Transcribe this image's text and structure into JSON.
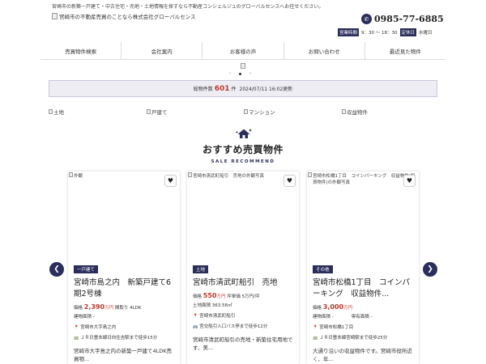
{
  "header": {
    "tagline": "宮崎市の新築一戸建て・中古住宅・売地・土地情報を探すなら不動産コンシェルジュのグローバルセンスへお任せください。",
    "logo_alt": "宮崎市の不動産売買のことなら株式会社グローバルセンス",
    "phone": "0985-77-6885",
    "hours_label": "営業時間",
    "hours_value": "9：30 ～ 18：30",
    "holiday_label": "定休日",
    "holiday_value": "水曜日"
  },
  "nav": [
    {
      "label": "売買物件検索"
    },
    {
      "label": "会社案内"
    },
    {
      "label": "お客様の声"
    },
    {
      "label": "お問い合わせ"
    },
    {
      "label": "最近見た物件"
    }
  ],
  "slider": {
    "prev": "‹",
    "next": "›"
  },
  "counter": {
    "label": "総物件数",
    "count": "601",
    "unit": "件",
    "updated": "2024/07/11 16:02更新"
  },
  "categories": [
    {
      "label": "土地"
    },
    {
      "label": "戸建て"
    },
    {
      "label": "マンション"
    },
    {
      "label": "収益物件"
    }
  ],
  "section": {
    "title": "おすすめ売買物件",
    "subtitle": "SALE RECOMMEND"
  },
  "cards": [
    {
      "img_alt": "外観",
      "badge": "一戸建て",
      "title": "宮崎市島之内　新築戸建て6期2号棟",
      "price_label": "価格",
      "price_value": "2,390",
      "price_unit": "万円",
      "extra": "間取り 4LDK",
      "spec_line": "建物面積 -",
      "address": "宮崎市大字島之内",
      "access": "ＪＲ日豊本線日向住吉駅まで徒歩15分",
      "desc": "宮崎市大字島之内の新築一戸建て4LDK売買物..."
    },
    {
      "img_alt": "宮崎市清武町船引　売地の外観写真",
      "badge": "土地",
      "title": "宮崎市清武町船引　売地",
      "price_label": "価格",
      "price_value": "550",
      "price_unit": "万円",
      "extra": "坪単価 5万円/坪",
      "spec_line": "土地面積 363.58㎡",
      "address": "宮崎市清武町船引",
      "access": "宮交船引入口バス停まで徒歩12分",
      "desc": "宮崎市清武町船引の売地・新築住宅用地です、美..."
    },
    {
      "img_alt": "宮崎市松橋1丁目　コインパーキング　収益物件(投資物件)の外観写真",
      "badge": "その他",
      "title": "宮崎市松橋1丁目　コインパーキング　収益物件...",
      "price_label": "価格",
      "price_value": "3,000",
      "price_unit": "万円",
      "extra": "",
      "spec_line": "建物面積 -　　　　専有面積 -",
      "address": "宮崎市松橋1丁目",
      "access": "ＪＲ日豊本線宮崎駅まで徒歩25分",
      "desc": "大通り沿いの収益物件です。宮崎市役所近く、年..."
    }
  ],
  "icons": {
    "phone": "phone-icon",
    "heart": "heart-icon",
    "pin": "map-pin-icon",
    "train": "train-icon"
  },
  "colors": {
    "navy": "#2b2e5c",
    "price_red": "#c0392b",
    "counter_bg": "#eeedf4"
  }
}
